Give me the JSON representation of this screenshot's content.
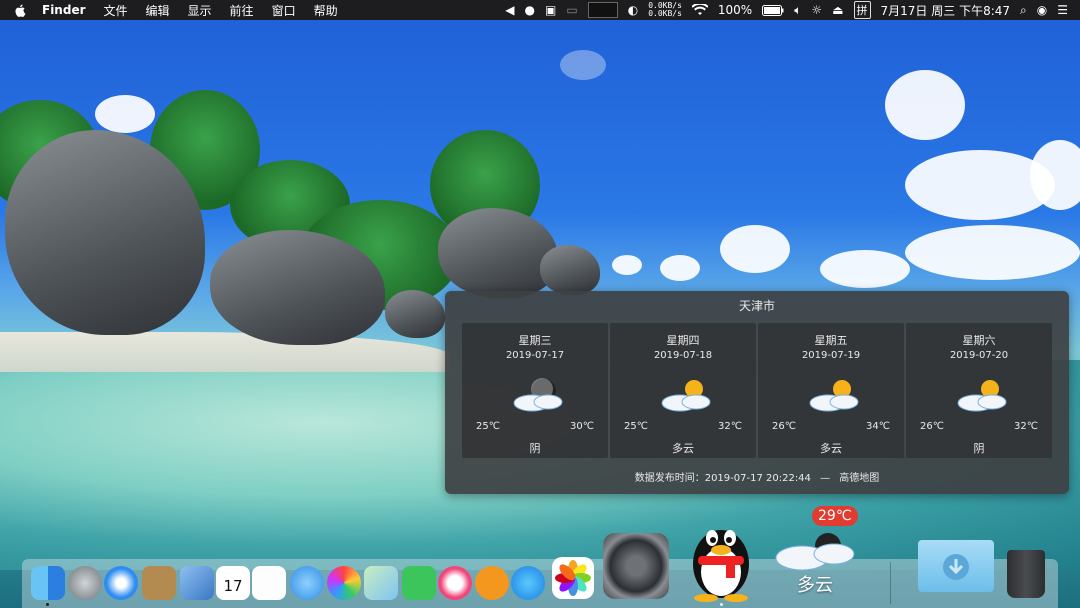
{
  "menubar": {
    "app": "Finder",
    "menus": [
      "文件",
      "编辑",
      "显示",
      "前往",
      "窗口",
      "帮助"
    ],
    "net_up": "0.0KB/s",
    "net_down": "0.0KB/s",
    "battery": "100%",
    "input_method": "拼",
    "datetime": "7月17日 周三 下午8:47"
  },
  "weather_widget": {
    "city": "天津市",
    "days": [
      {
        "weekday": "星期三",
        "date": "2019-07-17",
        "low": "25℃",
        "high": "30℃",
        "condition": "阴",
        "icon": "cloudy-night-icon"
      },
      {
        "weekday": "星期四",
        "date": "2019-07-18",
        "low": "25℃",
        "high": "32℃",
        "condition": "多云",
        "icon": "partly-cloudy-icon"
      },
      {
        "weekday": "星期五",
        "date": "2019-07-19",
        "low": "26℃",
        "high": "34℃",
        "condition": "多云",
        "icon": "partly-cloudy-icon"
      },
      {
        "weekday": "星期六",
        "date": "2019-07-20",
        "low": "26℃",
        "high": "32℃",
        "condition": "阴",
        "icon": "partly-cloudy-icon"
      }
    ],
    "publish_label": "数据发布时间：2019-07-17 20:22:44",
    "dash": "—",
    "source": "高德地图"
  },
  "dock": {
    "weather_badge": "29℃",
    "weather_condition": "多云"
  },
  "colors": {
    "menubar_bg": "#1d1d1f",
    "widget_bg": "#3e4042",
    "badge_red": "#e23b30"
  }
}
